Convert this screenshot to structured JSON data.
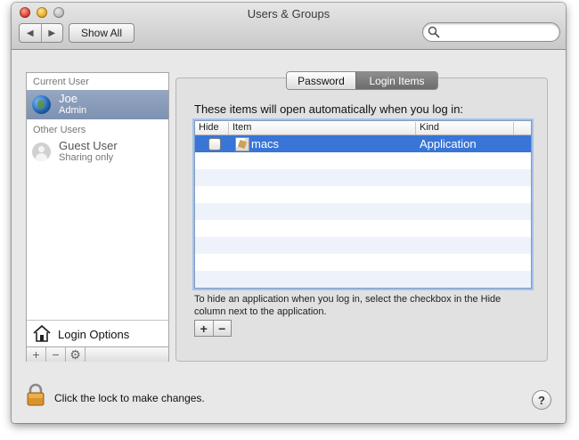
{
  "window": {
    "title": "Users & Groups"
  },
  "toolbar": {
    "back_glyph": "◀",
    "forward_glyph": "▶",
    "show_all_label": "Show All",
    "search": {
      "placeholder": "",
      "value": ""
    }
  },
  "sidebar": {
    "current_user_header": "Current User",
    "current_user": {
      "name": "Joe",
      "role": "Admin",
      "icon": "globe-icon"
    },
    "other_users_header": "Other Users",
    "other_users": [
      {
        "name": "Guest User",
        "role": "Sharing only",
        "icon": "guest-user-icon"
      }
    ],
    "login_options_label": "Login Options",
    "footer": {
      "add": "+",
      "remove": "−",
      "action": "⚙"
    }
  },
  "tabs": [
    {
      "label": "Password",
      "selected": false
    },
    {
      "label": "Login Items",
      "selected": true
    }
  ],
  "login_items": {
    "heading": "These items will open automatically when you log in:",
    "columns": {
      "hide": "Hide",
      "item": "Item",
      "kind": "Kind"
    },
    "rows": [
      {
        "hide": false,
        "item": "macs",
        "kind": "Application",
        "selected": true
      }
    ],
    "hint": "To hide an application when you log in, select the checkbox in the Hide column next to the application.",
    "add_label": "+",
    "remove_label": "−"
  },
  "footer": {
    "lock_message": "Click the lock to make changes.",
    "help_label": "?"
  },
  "colors": {
    "selection": "#3875d7",
    "sidebar_selection": "#7d91b1",
    "focus_ring": "#a6c1e6"
  }
}
